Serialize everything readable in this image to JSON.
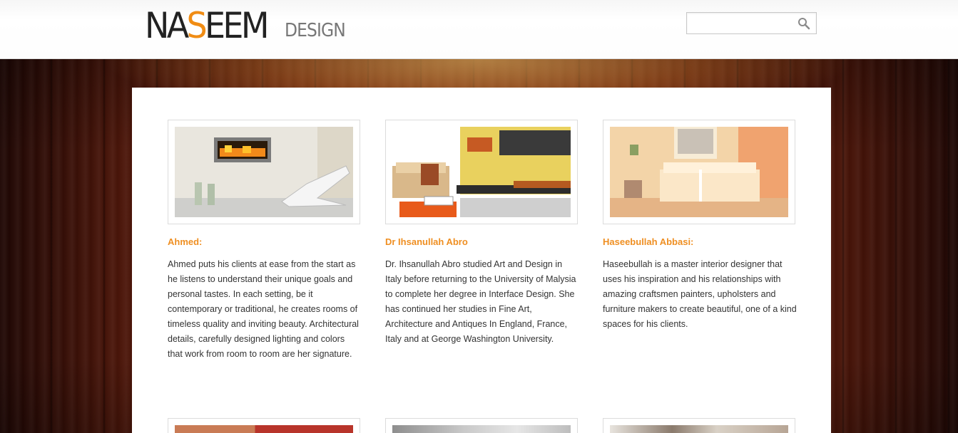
{
  "brand": {
    "main_prefix": "NA",
    "main_accent": "S",
    "main_suffix": "EEM",
    "sub": "DESIGN",
    "accent_color": "#f08c14"
  },
  "search": {
    "placeholder": "",
    "value": "",
    "icon": "search-icon"
  },
  "designers": [
    {
      "name": "Ahmed:",
      "description": "Ahmed puts his clients at ease from the start as he listens to understand their unique goals and personal tastes. In each setting, be it contemporary or traditional, he creates rooms of timeless quality and inviting beauty. Architectural details, carefully designed lighting and colors that work from room to room are her signature.",
      "image": "fireplace-living-room-photo"
    },
    {
      "name": "Dr Ihsanullah Abro",
      "description": "Dr. Ihsanullah Abro studied Art and Design in Italy before returning to the University of Malysia to complete her degree in Interface Design. She has continued her studies in Fine Art, Architecture and Antiques In England, France, Italy and at George Washington University.",
      "image": "modern-lounge-photo"
    },
    {
      "name": "Haseebullah Abbasi:",
      "description": "Haseebullah is a master interior designer that uses his inspiration and his relationships with amazing craftsmen painters, upholsters and furniture makers to create beautiful, one of a kind spaces for his clients.",
      "image": "warm-interior-photo"
    }
  ],
  "colors": {
    "name_color": "#ef8f22",
    "text_color": "#333333"
  }
}
